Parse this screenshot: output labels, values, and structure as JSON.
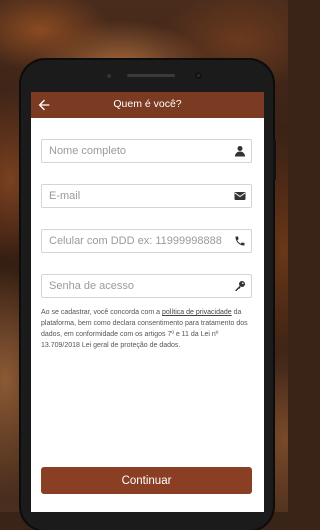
{
  "appbar": {
    "title": "Quem é você?"
  },
  "form": {
    "name_placeholder": "Nome completo",
    "email_placeholder": "E-mail",
    "phone_placeholder": "Celular com DDD ex: 11999998888",
    "password_placeholder": "Senha de acesso"
  },
  "legal": {
    "before_link": "Ao se cadastrar, você concorda com a ",
    "link": "política de privacidade",
    "after_link": " da plataforma, bem como declara consentimento para tratamento dos dados, em conformidade com os artigos 7º e 11 da Lei nº 13.709/2018 Lei geral de proteção de dados."
  },
  "actions": {
    "continue_label": "Continuar"
  },
  "colors": {
    "primary": "#8a3f25",
    "appbar": "#7b3a22"
  },
  "icons": {
    "back": "arrow-left-icon",
    "name": "user-icon",
    "email": "envelope-icon",
    "phone": "phone-icon",
    "password": "key-icon"
  }
}
